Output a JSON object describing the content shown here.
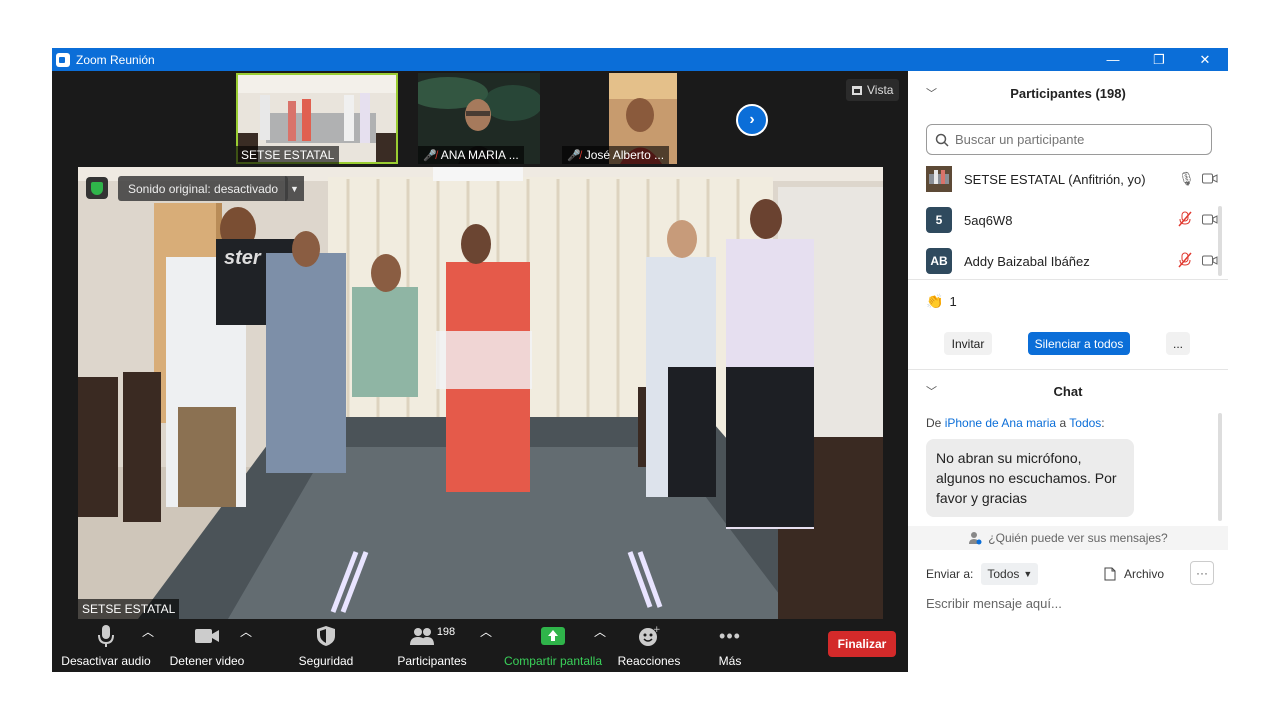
{
  "window": {
    "title": "Zoom Reunión",
    "controls": {
      "minimize": "—",
      "restore": "❐",
      "close": "✕"
    }
  },
  "thumbnails": [
    {
      "name": "SETSE ESTATAL",
      "muted": false,
      "highlighted": true
    },
    {
      "name": "ANA MARIA ...",
      "muted": true,
      "highlighted": false
    },
    {
      "name": "José Alberto ...",
      "muted": true,
      "highlighted": false
    }
  ],
  "view_button": {
    "label": "Vista"
  },
  "main_video": {
    "label": "SETSE ESTATAL",
    "sound_status": "Sonido original: desactivado",
    "box_text": "ster"
  },
  "toolbar": {
    "mute_label": "Desactivar audio",
    "video_label": "Detener video",
    "security_label": "Seguridad",
    "participants_label": "Participantes",
    "participants_count": "198",
    "share_label": "Compartir pantalla",
    "reactions_label": "Reacciones",
    "more_label": "Más",
    "end_label": "Finalizar"
  },
  "participants_panel": {
    "title": "Participantes (198)",
    "search_placeholder": "Buscar un participante",
    "items": [
      {
        "name": "SETSE ESTATAL (Anfitrión, yo)",
        "avatar_text": "",
        "avatar_color": "#6b5a44",
        "mic_muted": false
      },
      {
        "name": "5aq6W8",
        "avatar_text": "5",
        "avatar_color": "#2f4a5e",
        "mic_muted": true
      },
      {
        "name": "Addy Baizabal Ibáñez",
        "avatar_text": "AB",
        "avatar_color": "#2f4a5e",
        "mic_muted": true
      }
    ],
    "reaction_emoji": "👏",
    "reaction_count": "1",
    "invite_label": "Invitar",
    "mute_all_label": "Silenciar a todos",
    "more_label": "..."
  },
  "chat_panel": {
    "title": "Chat",
    "from_prefix": "De",
    "sender": "iPhone de Ana maria",
    "to_word": "a",
    "recipient": "Todos",
    "message": "No abran su micrófono, algunos no escuchamos. Por favor y gracias",
    "who_can_see": "¿Quién puede ver sus mensajes?",
    "send_to_label": "Enviar a:",
    "send_to_value": "Todos",
    "file_label": "Archivo",
    "more_label": "···",
    "input_placeholder": "Escribir mensaje aquí..."
  },
  "colors": {
    "accent": "#0b6ed8",
    "end_button": "#d32a2a",
    "share_green": "#2fb44a",
    "mic_muted": "#e0392f"
  }
}
